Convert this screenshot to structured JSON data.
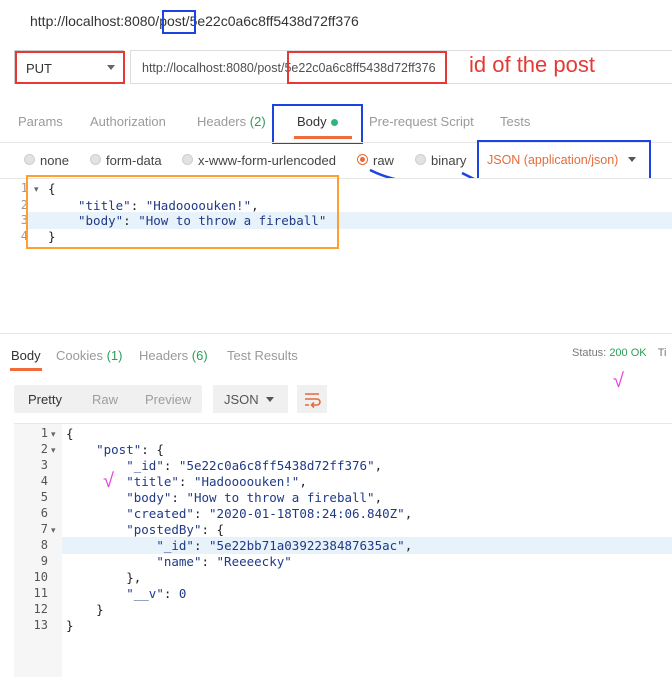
{
  "header": {
    "url_prefix": "http://localhost:8080/",
    "url_post": "post",
    "url_sep": "/",
    "url_id": "5e22c0a6c8ff5438d72ff376"
  },
  "request": {
    "method": "PUT",
    "url_base": "http://localhost:8080/post/",
    "url_id": "5e22c0a6c8ff5438d72ff376",
    "annotation": "id of the post"
  },
  "request_tabs": {
    "params": "Params",
    "authorization": "Authorization",
    "headers": "Headers",
    "headers_count": "(2)",
    "body": "Body",
    "pre_request": "Pre-request Script",
    "tests": "Tests"
  },
  "body_types": {
    "none": "none",
    "form_data": "form-data",
    "urlencoded": "x-www-form-urlencoded",
    "raw": "raw",
    "binary": "binary",
    "selected": "raw",
    "format": "JSON (application/json)"
  },
  "request_body": {
    "lines": [
      "1",
      "2",
      "3",
      "4"
    ],
    "open": "{",
    "title_key": "\"title\"",
    "title_val": "\"Hadoooouken!\"",
    "body_key": "\"body\"",
    "body_val": "\"How to throw a fireball\"",
    "close": "}"
  },
  "response_tabs": {
    "body": "Body",
    "cookies": "Cookies",
    "cookies_count": "(1)",
    "headers": "Headers",
    "headers_count": "(6)",
    "test_results": "Test Results"
  },
  "status": {
    "label": "Status:",
    "value": "200 OK",
    "cut": "Ti"
  },
  "response_toolbar": {
    "pretty": "Pretty",
    "raw": "Raw",
    "preview": "Preview",
    "format": "JSON"
  },
  "response_body": {
    "line_numbers": [
      "1",
      "2",
      "3",
      "4",
      "5",
      "6",
      "7",
      "8",
      "9",
      "10",
      "11",
      "12",
      "13"
    ],
    "post_key": "\"post\"",
    "id_key": "\"_id\"",
    "id_val": "\"5e22c0a6c8ff5438d72ff376\"",
    "title_key": "\"title\"",
    "title_val": "\"Hadoooouken!\"",
    "body_key": "\"body\"",
    "body_val": "\"How to throw a fireball\"",
    "created_key": "\"created\"",
    "created_val": "\"2020-01-18T08:24:06.840Z\"",
    "postedby_key": "\"postedBy\"",
    "pb_id_key": "\"_id\"",
    "pb_id_val": "\"5e22bb71a0392238487635ac\"",
    "name_key": "\"name\"",
    "name_val": "\"Reeeecky\"",
    "v_key": "\"__v\"",
    "v_val": "0"
  },
  "annotations": {
    "checkmark": "√"
  },
  "colors": {
    "accent": "#f26b3a",
    "annotation_red": "#e53935",
    "annotation_blue": "#1a45e0",
    "annotation_orange": "#ff9f2d",
    "status_green": "#2a9e5a",
    "checkmark_pink": "#e83fe0"
  }
}
